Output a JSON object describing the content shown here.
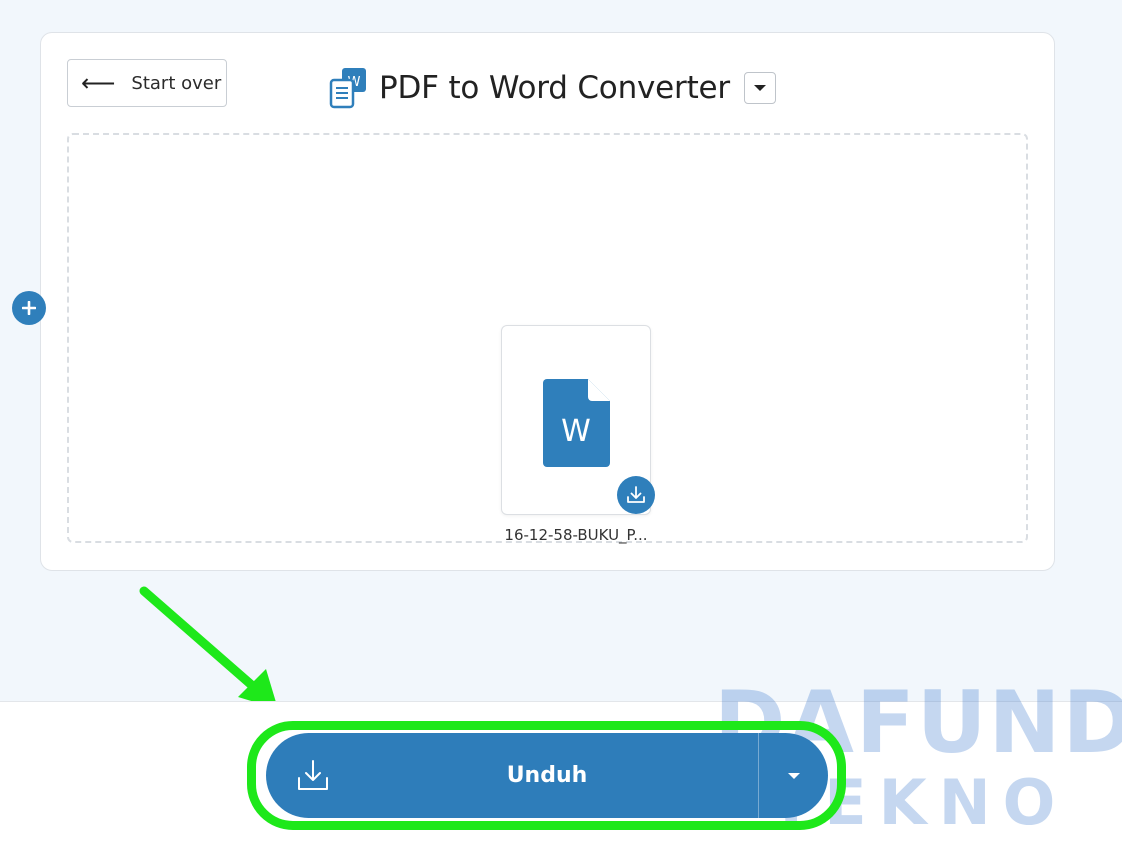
{
  "header": {
    "start_over_label": "Start over",
    "title": "PDF to Word Converter"
  },
  "file": {
    "name": "16-12-58-BUKU_P...",
    "type_letter": "W"
  },
  "download_button": {
    "label": "Unduh"
  },
  "watermark": {
    "line1": "DAFUNDA",
    "line2": "TEKNO"
  },
  "colors": {
    "accent": "#2e7dba",
    "highlight": "#1ee81a",
    "background": "#f2f7fc"
  },
  "icons": [
    "arrow-left-icon",
    "word-app-icon",
    "chevron-down-icon",
    "plus-icon",
    "word-document-icon",
    "download-icon"
  ]
}
